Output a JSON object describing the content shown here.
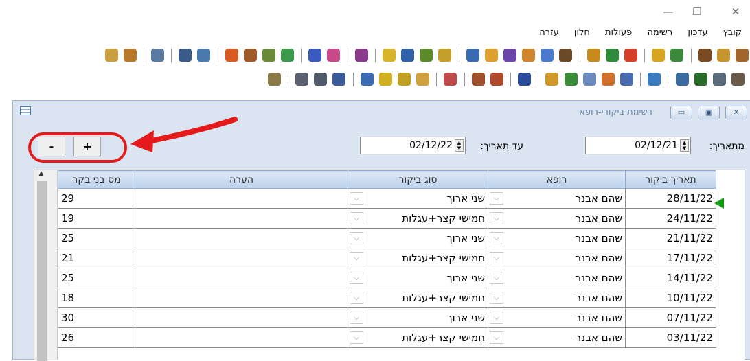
{
  "window_controls": {
    "minimize": "—",
    "restore": "❐",
    "close": "✕"
  },
  "menu": [
    "קובץ",
    "עדכון",
    "רשימה",
    "פעולות",
    "חלון",
    "עזרה"
  ],
  "child": {
    "title": "רשימת ביקורי-רופא",
    "btn_close": "✕",
    "btn_max": "▣",
    "btn_min": "▭"
  },
  "controls": {
    "plus": "+",
    "minus": "-",
    "from_label": "מתאריך:",
    "from_value": "02/12/21",
    "to_label": "עד תאריך:",
    "to_value": "02/12/22"
  },
  "grid": {
    "columns": [
      "תאריך ביקור",
      "רופא",
      "סוג ביקור",
      "הערה",
      "מס בני בקר"
    ],
    "rows": [
      {
        "date": "28/11/22",
        "doctor": "שהם אבנר",
        "type": "שני ארוך",
        "note": "",
        "count": "29"
      },
      {
        "date": "24/11/22",
        "doctor": "שהם אבנר",
        "type": "חמישי קצר+עגלות",
        "note": "",
        "count": "19"
      },
      {
        "date": "21/11/22",
        "doctor": "שהם אבנר",
        "type": "שני ארוך",
        "note": "",
        "count": "25"
      },
      {
        "date": "17/11/22",
        "doctor": "שהם אבנר",
        "type": "חמישי קצר+עגלות",
        "note": "",
        "count": "21"
      },
      {
        "date": "14/11/22",
        "doctor": "שהם אבנר",
        "type": "שני ארוך",
        "note": "",
        "count": "25"
      },
      {
        "date": "10/11/22",
        "doctor": "שהם אבנר",
        "type": "חמישי קצר+עגלות",
        "note": "",
        "count": "18"
      },
      {
        "date": "07/11/22",
        "doctor": "שהם אבנר",
        "type": "שני ארוך",
        "note": "",
        "count": "30"
      },
      {
        "date": "03/11/22",
        "doctor": "שהם אבנר",
        "type": "חמישי קצר+עגלות",
        "note": "",
        "count": "26"
      }
    ]
  },
  "colors": {
    "highlight_circle": "#e51b1b",
    "row_indicator": "#1a9a1a",
    "child_bg": "#dbe5f1",
    "header_bg": "#bcd2ec"
  }
}
